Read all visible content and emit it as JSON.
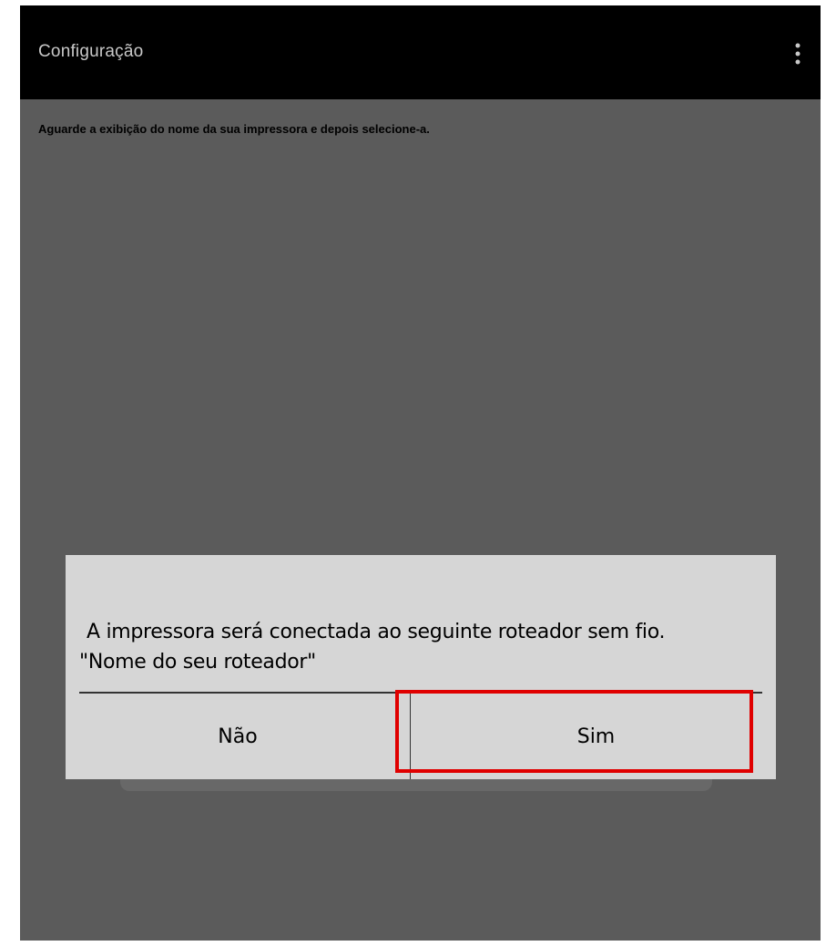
{
  "action_bar": {
    "title": "Configuração",
    "menu_icon": "overflow-menu-icon"
  },
  "screen": {
    "instruction": "Aguarde a exibição do nome da sua impressora e depois selecione-a."
  },
  "dialog": {
    "message_line1": "A impressora será conectada ao seguinte roteador sem fio.",
    "message_line2": "\"Nome do seu roteador\"",
    "no_label": "Não",
    "yes_label": "Sim"
  },
  "colors": {
    "action_bar": "#000000",
    "background": "#5b5b5b",
    "dialog": "#d6d6d6",
    "highlight": "#e00000"
  }
}
